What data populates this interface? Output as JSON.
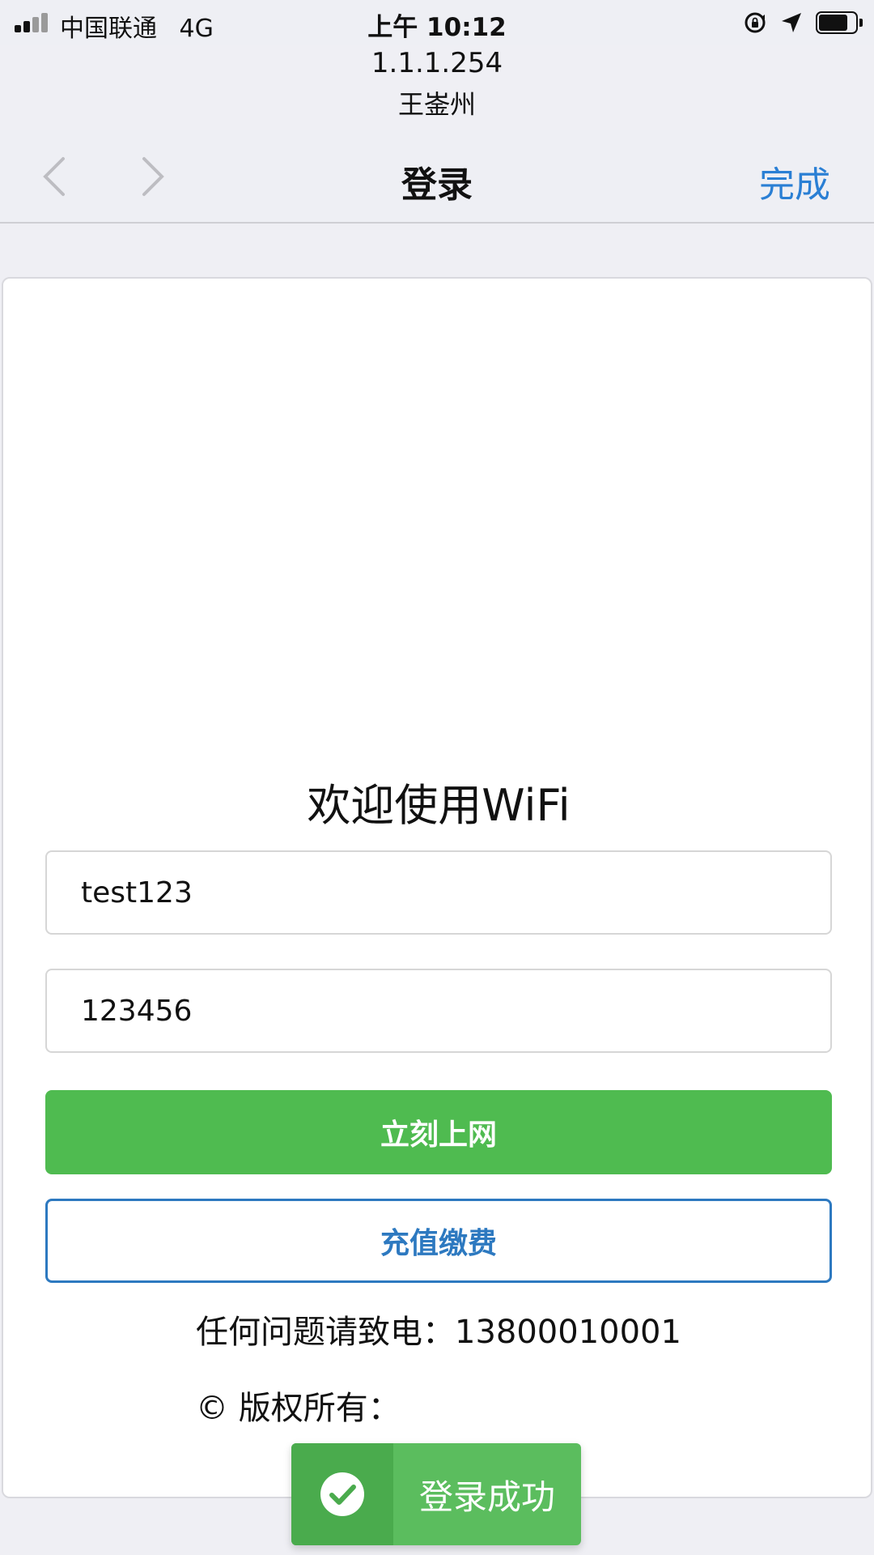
{
  "status_bar": {
    "carrier": "中国联通",
    "network": "4G",
    "time": "上午 10:12",
    "battery_level": 0.8
  },
  "captive": {
    "host": "1.1.1.254",
    "ssid": "王崟州"
  },
  "nav": {
    "title": "登录",
    "done_label": "完成"
  },
  "form": {
    "welcome": "欢迎使用WiFi",
    "username_value": "test123",
    "password_value": "123456",
    "connect_label": "立刻上网",
    "recharge_label": "充值缴费",
    "contact_text": "任何问题请致电：13800010001",
    "copyright_text": "© 版权所有："
  },
  "toast": {
    "message": "登录成功"
  },
  "colors": {
    "primary_green": "#4fbb50",
    "link_blue": "#2a7fd4",
    "toast_green": "#5bbd5e"
  },
  "icons": [
    "signal-icon",
    "orientation-lock-icon",
    "location-icon",
    "battery-icon",
    "chevron-left-icon",
    "chevron-right-icon",
    "checkmark-icon"
  ]
}
